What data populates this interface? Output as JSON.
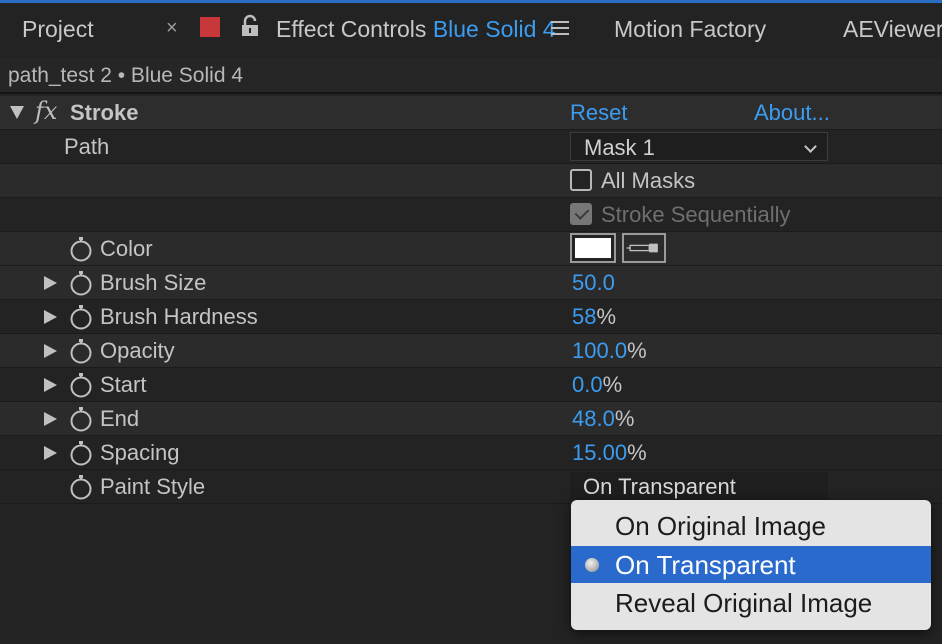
{
  "tabs": {
    "project": "Project",
    "close": "×",
    "effect_prefix": "Effect Controls",
    "effect_layer": "Blue Solid 4",
    "motion_factory": "Motion Factory",
    "aeviewer": "AEViewer"
  },
  "breadcrumb": "path_test 2 • Blue Solid 4",
  "effect": {
    "name": "Stroke",
    "fx_symbol": "fx",
    "reset": "Reset",
    "about": "About..."
  },
  "path": {
    "label": "Path",
    "value": "Mask 1"
  },
  "all_masks": {
    "label": "All Masks",
    "checked": false
  },
  "stroke_sequentially": {
    "label": "Stroke Sequentially",
    "checked": true,
    "enabled": false
  },
  "color": {
    "label": "Color",
    "value": "#ffffff"
  },
  "properties": [
    {
      "label": "Brush Size",
      "value": "50.0",
      "unit": ""
    },
    {
      "label": "Brush Hardness",
      "value": "58",
      "unit": "%"
    },
    {
      "label": "Opacity",
      "value": "100.0",
      "unit": "%"
    },
    {
      "label": "Start",
      "value": "0.0",
      "unit": "%"
    },
    {
      "label": "End",
      "value": "48.0",
      "unit": "%"
    },
    {
      "label": "Spacing",
      "value": "15.00",
      "unit": "%"
    }
  ],
  "paint_style": {
    "label": "Paint Style",
    "value": "On Transparent",
    "options": [
      "On Original Image",
      "On Transparent",
      "Reveal Original Image"
    ],
    "selected_index": 1
  },
  "colors": {
    "accent": "#3b9cf0",
    "selection": "#2a6acd",
    "swatch_red": "#c8383a"
  }
}
